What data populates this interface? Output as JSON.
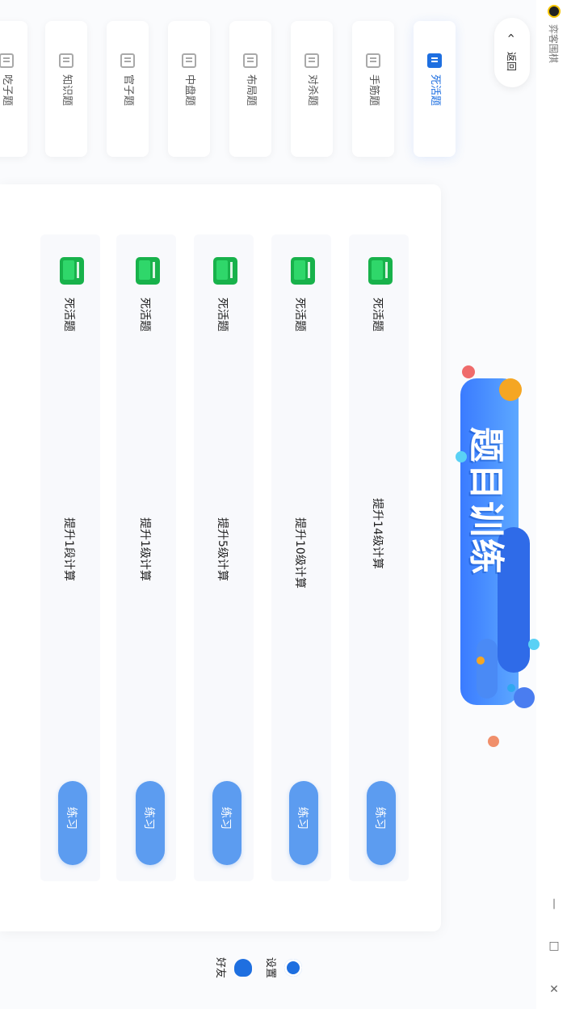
{
  "window": {
    "app_title": "弈客围棋",
    "controls": {
      "minimize_glyph": "—",
      "maximize_glyph": "□",
      "close_glyph": "✕"
    }
  },
  "nav": {
    "back_label": "返回",
    "back_icon": "chevron-up-icon"
  },
  "tabs": [
    {
      "label": "死活题",
      "active": true
    },
    {
      "label": "手筋题",
      "active": false
    },
    {
      "label": "对杀题",
      "active": false
    },
    {
      "label": "布局题",
      "active": false
    },
    {
      "label": "中盘题",
      "active": false
    },
    {
      "label": "官子题",
      "active": false
    },
    {
      "label": "知识题",
      "active": false
    },
    {
      "label": "吃子题",
      "active": false
    }
  ],
  "hero": {
    "title": "题目训练"
  },
  "exercises": [
    {
      "type": "死活题",
      "description": "提升14级计算",
      "button": "练习"
    },
    {
      "type": "死活题",
      "description": "提升10级计算",
      "button": "练习"
    },
    {
      "type": "死活题",
      "description": "提升5级计算",
      "button": "练习"
    },
    {
      "type": "死活题",
      "description": "提升1级计算",
      "button": "练习"
    },
    {
      "type": "死活题",
      "description": "提升1段计算",
      "button": "练习"
    }
  ],
  "footer": {
    "settings_label": "设置",
    "friends_label": "好友"
  },
  "colors": {
    "accent": "#1e6fe0",
    "practice_button": "#5c9cf0",
    "exercise_icon": "#18b24b"
  }
}
